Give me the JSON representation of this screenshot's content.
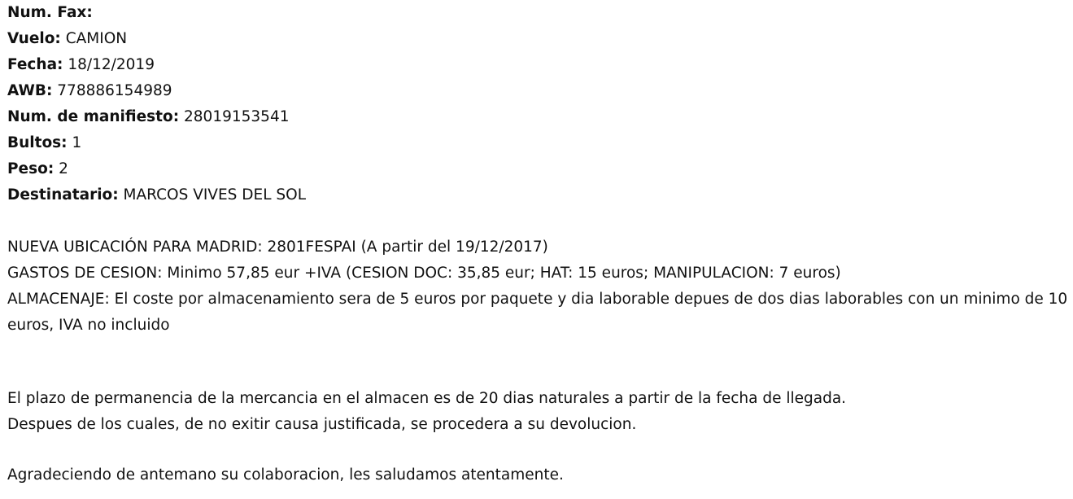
{
  "header_fields": [
    {
      "label": "Num. Fax:",
      "value": ""
    },
    {
      "label": "Vuelo:",
      "value": " CAMION"
    },
    {
      "label": "Fecha:",
      "value": " 18/12/2019"
    },
    {
      "label": "AWB:",
      "value": " 778886154989"
    },
    {
      "label": "Num. de manifiesto:",
      "value": " 28019153541"
    },
    {
      "label": "Bultos:",
      "value": " 1"
    },
    {
      "label": "Peso:",
      "value": " 2"
    },
    {
      "label": "Destinatario:",
      "value": " MARCOS VIVES DEL SOL"
    }
  ],
  "notices": {
    "ubicacion": "NUEVA UBICACIÓN PARA MADRID: 2801FESPAI (A partir del 19/12/2017)",
    "gastos": "GASTOS DE CESION: Minimo 57,85 eur +IVA (CESION DOC: 35,85 eur; HAT: 15 euros; MANIPULACION: 7 euros)",
    "almacenaje": "ALMACENAJE: El coste por almacenamiento sera de 5 euros por paquete y dia laborable depues de dos dias laborables con un minimo de 10 euros, IVA no incluido"
  },
  "plazo": {
    "line1": "El plazo de permanencia de la mercancia en el almacen es de 20 dias naturales a partir de la fecha de llegada.",
    "line2": "Despues de los cuales, de no exitir causa justificada, se procedera a su devolucion."
  },
  "closing": "Agradeciendo de antemano su colaboracion, les saludamos atentamente."
}
